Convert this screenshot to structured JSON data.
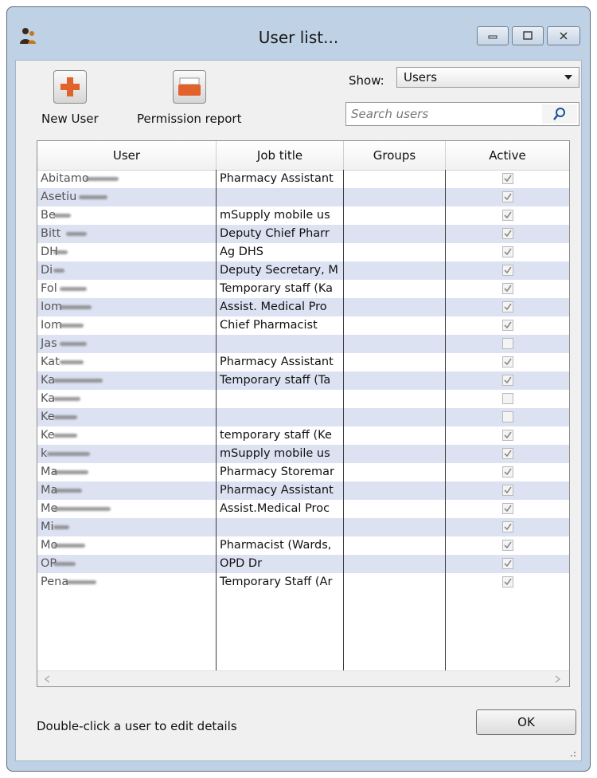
{
  "window": {
    "title": "User list..."
  },
  "toolbar": {
    "new_user_label": "New User",
    "permission_report_label": "Permission report"
  },
  "filter": {
    "show_label": "Show:",
    "show_value": "Users",
    "search_placeholder": "Search users"
  },
  "table": {
    "columns": [
      "User",
      "Job title",
      "Groups",
      "Active"
    ],
    "rows": [
      {
        "user": "Abitamo",
        "job": "Pharmacy Assistant",
        "groups": "",
        "active": true
      },
      {
        "user": "Asetiu",
        "job": "",
        "groups": "",
        "active": true
      },
      {
        "user": "Be",
        "job": "mSupply mobile us",
        "groups": "",
        "active": true
      },
      {
        "user": "Bitt",
        "job": "Deputy Chief Pharr",
        "groups": "",
        "active": true
      },
      {
        "user": "DH",
        "job": "Ag DHS",
        "groups": "",
        "active": true
      },
      {
        "user": "Di",
        "job": "Deputy Secretary, M",
        "groups": "",
        "active": true
      },
      {
        "user": "Fol",
        "job": "Temporary staff (Ka",
        "groups": "",
        "active": true
      },
      {
        "user": "Iom",
        "job": "Assist. Medical Pro",
        "groups": "",
        "active": true
      },
      {
        "user": "Iom",
        "job": "Chief Pharmacist",
        "groups": "",
        "active": true
      },
      {
        "user": "Jas",
        "job": "",
        "groups": "",
        "active": false
      },
      {
        "user": "Kat",
        "job": "Pharmacy Assistant",
        "groups": "",
        "active": true
      },
      {
        "user": "Ka",
        "job": "Temporary staff (Ta",
        "groups": "",
        "active": true
      },
      {
        "user": "Ka",
        "job": "",
        "groups": "",
        "active": false
      },
      {
        "user": "Ke",
        "job": "",
        "groups": "",
        "active": false
      },
      {
        "user": "Ke",
        "job": "temporary staff (Ke",
        "groups": "",
        "active": true
      },
      {
        "user": "k",
        "job": "mSupply mobile us",
        "groups": "",
        "active": true
      },
      {
        "user": "Ma",
        "job": "Pharmacy Storemar",
        "groups": "",
        "active": true
      },
      {
        "user": "Ma",
        "job": "Pharmacy Assistant",
        "groups": "",
        "active": true
      },
      {
        "user": "Me",
        "job": "Assist.Medical Proc",
        "groups": "",
        "active": true
      },
      {
        "user": "Mi",
        "job": "",
        "groups": "",
        "active": true
      },
      {
        "user": "Mo",
        "job": "Pharmacist (Wards,",
        "groups": "",
        "active": true
      },
      {
        "user": "OP",
        "job": "OPD Dr",
        "groups": "",
        "active": true
      },
      {
        "user": "Pena",
        "job": "Temporary Staff (Ar",
        "groups": "",
        "active": true
      }
    ]
  },
  "footer": {
    "hint": "Double-click a user to edit details",
    "ok_label": "OK"
  }
}
